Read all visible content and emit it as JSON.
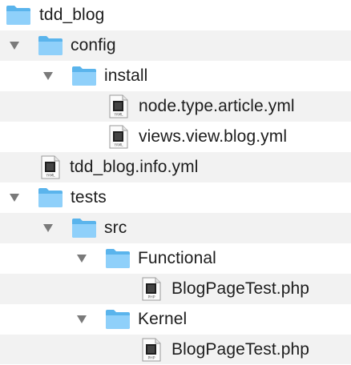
{
  "tree": {
    "items": [
      {
        "label": "tdd_blog",
        "kind": "folder",
        "icon": "folder-icon",
        "expanded": true
      },
      {
        "label": "config",
        "kind": "folder",
        "icon": "folder-icon",
        "expanded": true
      },
      {
        "label": "install",
        "kind": "folder",
        "icon": "folder-icon",
        "expanded": true
      },
      {
        "label": "node.type.article.yml",
        "kind": "file",
        "icon": "yaml-file-icon",
        "badge": "YAML"
      },
      {
        "label": "views.view.blog.yml",
        "kind": "file",
        "icon": "yaml-file-icon",
        "badge": "YAML"
      },
      {
        "label": "tdd_blog.info.yml",
        "kind": "file",
        "icon": "yaml-file-icon",
        "badge": "YAML"
      },
      {
        "label": "tests",
        "kind": "folder",
        "icon": "folder-icon",
        "expanded": true
      },
      {
        "label": "src",
        "kind": "folder",
        "icon": "folder-icon",
        "expanded": true
      },
      {
        "label": "Functional",
        "kind": "folder",
        "icon": "folder-icon",
        "expanded": true
      },
      {
        "label": "BlogPageTest.php",
        "kind": "file",
        "icon": "php-file-icon",
        "badge": "PHP"
      },
      {
        "label": "Kernel",
        "kind": "folder",
        "icon": "folder-icon",
        "expanded": true
      },
      {
        "label": "BlogPageTest.php",
        "kind": "file",
        "icon": "php-file-icon",
        "badge": "PHP"
      }
    ]
  },
  "colors": {
    "folder": "#5ab4ec",
    "folder_light": "#8fd0fa",
    "row_alt": "#f2f2f2",
    "disclosure": "#7a7a7a"
  }
}
